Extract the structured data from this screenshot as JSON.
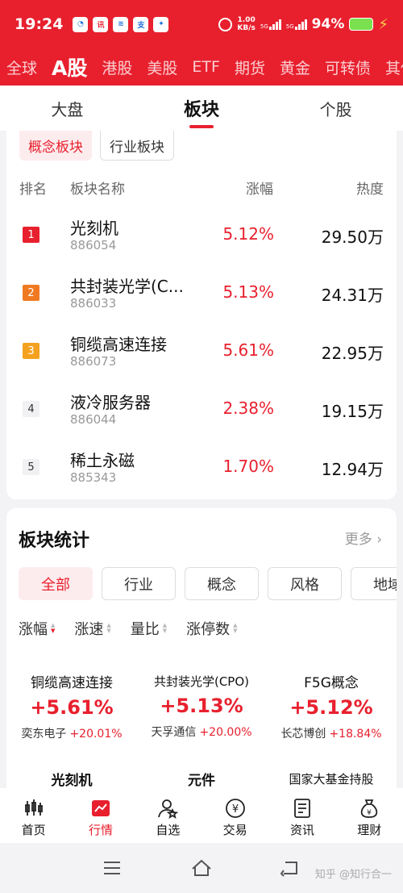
{
  "status_bar": {
    "time": "19:24",
    "apps": [
      {
        "label": "◔",
        "color": "blue"
      },
      {
        "label": "讯",
        "color": "red"
      },
      {
        "label": "≋",
        "color": "blue"
      },
      {
        "label": "支",
        "color": "blue"
      },
      {
        "label": "✦",
        "color": "blue"
      }
    ],
    "speed_top": "1.00",
    "speed_unit": "KB/s",
    "sig1_label": "5G",
    "sig2_label": "5G",
    "battery": "94%"
  },
  "market_tabs": [
    "全球",
    "A股",
    "港股",
    "美股",
    "ETF",
    "期货",
    "黄金",
    "可转债",
    "其他"
  ],
  "market_active_index": 1,
  "sub_tabs": [
    "大盘",
    "板块",
    "个股"
  ],
  "sub_active_index": 1,
  "sector_pills": [
    "概念板块",
    "行业板块"
  ],
  "table_headers": {
    "rank": "排名",
    "name": "板块名称",
    "change": "涨幅",
    "heat": "热度"
  },
  "rows": [
    {
      "rank": "1",
      "name": "光刻机",
      "code": "886054",
      "change": "5.12%",
      "heat": "29.50万",
      "style": "r1"
    },
    {
      "rank": "2",
      "name": "共封装光学(C...",
      "code": "886033",
      "change": "5.13%",
      "heat": "24.31万",
      "style": "r2"
    },
    {
      "rank": "3",
      "name": "铜缆高速连接",
      "code": "886073",
      "change": "5.61%",
      "heat": "22.95万",
      "style": "r3"
    },
    {
      "rank": "4",
      "name": "液冷服务器",
      "code": "886044",
      "change": "2.38%",
      "heat": "19.15万",
      "style": "plain"
    },
    {
      "rank": "5",
      "name": "稀土永磁",
      "code": "885343",
      "change": "1.70%",
      "heat": "12.94万",
      "style": "plain"
    }
  ],
  "stats": {
    "title": "板块统计",
    "more": "更多",
    "filters": [
      "全部",
      "行业",
      "概念",
      "风格",
      "地域"
    ],
    "sort_items": [
      "涨幅",
      "涨速",
      "量比",
      "涨停数"
    ],
    "cells": [
      {
        "name": "铜缆高速连接",
        "pct": "+5.61%",
        "lead": "奕东电子",
        "lead_pct": "+20.01%"
      },
      {
        "name": "共封装光学(CPO)",
        "pct": "+5.13%",
        "lead": "天孚通信",
        "lead_pct": "+20.00%"
      },
      {
        "name": "F5G概念",
        "pct": "+5.12%",
        "lead": "长芯博创",
        "lead_pct": "+18.84%"
      },
      {
        "name": "光刻机",
        "pct": "",
        "lead": "",
        "lead_pct": ""
      },
      {
        "name": "元件",
        "pct": "",
        "lead": "",
        "lead_pct": ""
      },
      {
        "name": "国家大基金持股",
        "pct": "",
        "lead": "",
        "lead_pct": ""
      }
    ]
  },
  "bottom_nav": [
    {
      "label": "首页",
      "icon": "home-chart-icon"
    },
    {
      "label": "行情",
      "icon": "market-icon"
    },
    {
      "label": "自选",
      "icon": "user-star-icon"
    },
    {
      "label": "交易",
      "icon": "yen-icon"
    },
    {
      "label": "资讯",
      "icon": "news-icon"
    },
    {
      "label": "理财",
      "icon": "money-bag-icon"
    }
  ],
  "bottom_active_index": 1,
  "watermark": "知乎 @知行合一",
  "colors": {
    "brand": "#e8202e",
    "up": "#e8202e",
    "rank2": "#f07a22",
    "rank3": "#f4a120"
  }
}
